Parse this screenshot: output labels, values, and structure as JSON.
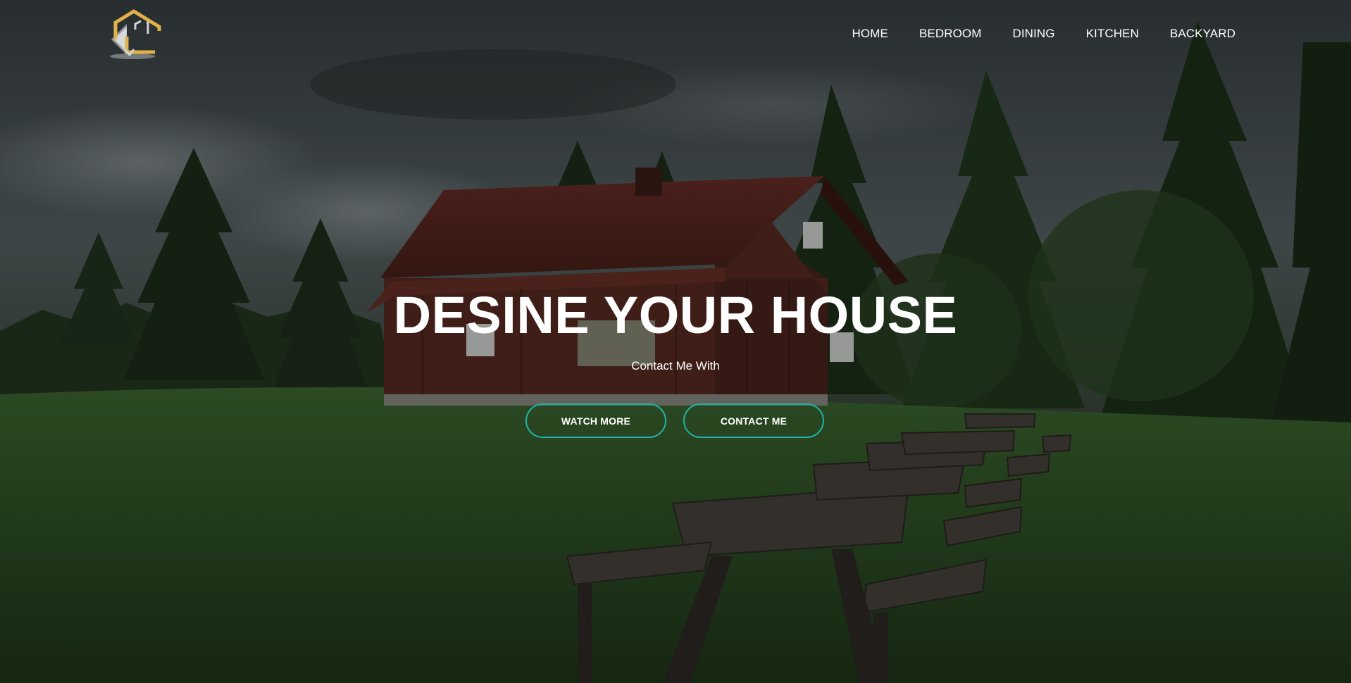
{
  "nav": {
    "items": [
      {
        "label": "HOME"
      },
      {
        "label": "BEDROOM"
      },
      {
        "label": "DINING"
      },
      {
        "label": "KITCHEN"
      },
      {
        "label": "BACKYARD"
      }
    ]
  },
  "hero": {
    "title": "DESINE YOUR HOUSE",
    "subtitle": "Contact Me With",
    "watch_button": "WATCH MORE",
    "contact_button": "CONTACT ME"
  },
  "colors": {
    "accent": "#1fb3a5",
    "logo_gold": "#e2b24a",
    "logo_silver": "#cfd3d6",
    "text": "#ffffff"
  },
  "icons": {
    "logo": "house-logo-icon"
  }
}
